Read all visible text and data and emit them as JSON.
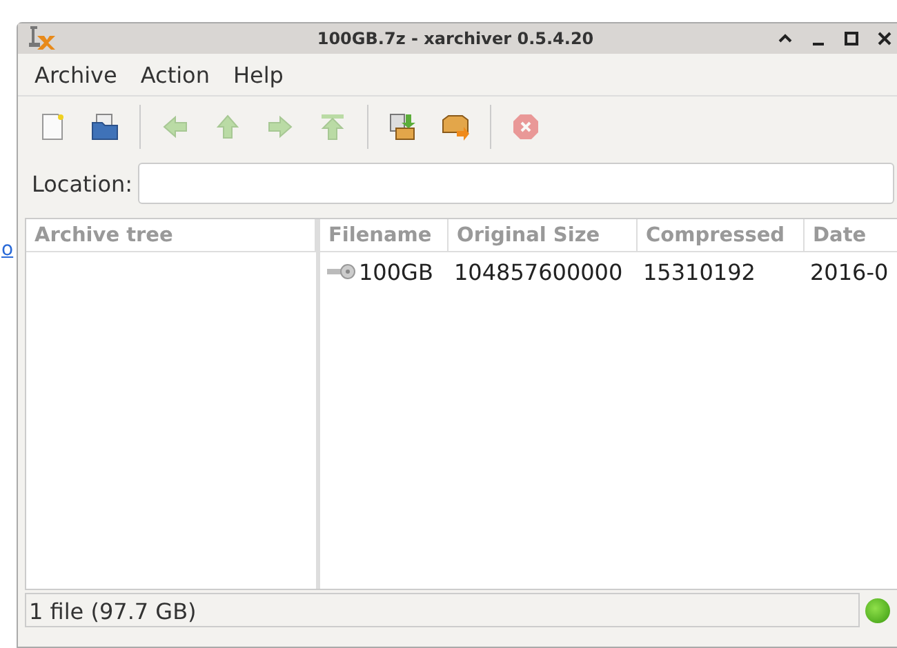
{
  "background_link": "o",
  "window": {
    "title": "100GB.7z - xarchiver 0.5.4.20"
  },
  "menu": [
    "Archive",
    "Action",
    "Help"
  ],
  "toolbar": [
    {
      "kind": "new",
      "disabled": false
    },
    {
      "kind": "open",
      "disabled": false
    },
    {
      "kind": "sep"
    },
    {
      "kind": "back",
      "disabled": true
    },
    {
      "kind": "up",
      "disabled": true
    },
    {
      "kind": "forward",
      "disabled": true
    },
    {
      "kind": "home",
      "disabled": true
    },
    {
      "kind": "sep"
    },
    {
      "kind": "extract",
      "disabled": false
    },
    {
      "kind": "add",
      "disabled": false
    },
    {
      "kind": "sep"
    },
    {
      "kind": "stop",
      "disabled": true
    }
  ],
  "location": {
    "label": "Location:"
  },
  "tree": {
    "heading": "Archive tree"
  },
  "table": {
    "columns": [
      "Filename",
      "Original Size",
      "Compressed",
      "Date"
    ],
    "rows": [
      {
        "cells": [
          "100GB",
          "104857600000",
          "15310192",
          "2016-0"
        ],
        "locked": true
      }
    ]
  },
  "status_bar": {
    "text": "1 file  (97.7 GB)"
  }
}
